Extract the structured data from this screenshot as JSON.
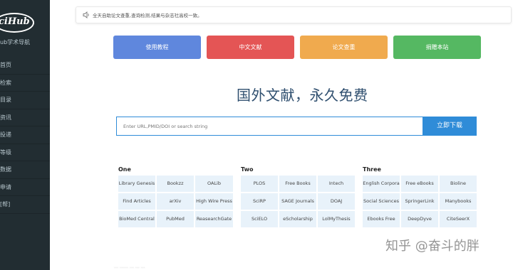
{
  "sidebar": {
    "logo_text": "ciHub",
    "subtitle": "ub学术导航",
    "items": [
      "首页",
      "检索",
      "目录",
      "资讯",
      "投递",
      "等级",
      "数据",
      "申请",
      "[帮]"
    ]
  },
  "notice": {
    "icon": "speaker-icon",
    "text": "全天自助论文查重,查询检测,结果与杂志社高校一致。"
  },
  "buttons": [
    "使用教程",
    "中文文献",
    "论文查重",
    "捐赠本站"
  ],
  "colors": {
    "tutorial": "#5f87dd",
    "chinese": "#e45555",
    "check": "#f0aa4e",
    "donate": "#55b862",
    "accent": "#2f8cd8",
    "sidebar": "#222d32"
  },
  "headline": "国外文献，永久免费",
  "search": {
    "placeholder": "Enter URL,PMID/DOI or search string",
    "button": "立即下载"
  },
  "groups": [
    {
      "title": "One",
      "links": [
        "Library Genesis",
        "Bookzz",
        "OALib",
        "Find Articles",
        "arXiv",
        "High Wire Press",
        "BioMed Central",
        "PubMed",
        "ReasearchGate"
      ]
    },
    {
      "title": "Two",
      "links": [
        "PLOS",
        "Free Books",
        "Intech",
        "SciRP",
        "SAGE Journals",
        "DOAJ",
        "SciELO",
        "eScholarship",
        "LolMyThesis"
      ]
    },
    {
      "title": "Three",
      "links": [
        "English Corpora",
        "Free eBooks",
        "Bioline",
        "Social Sciences",
        "SpringerLink",
        "Manybooks",
        "Ebooks Free",
        "DeepDyve",
        "CiteSeerX"
      ]
    }
  ],
  "watermark": "知乎 @奋斗的胖",
  "footer": "… …… … … …"
}
